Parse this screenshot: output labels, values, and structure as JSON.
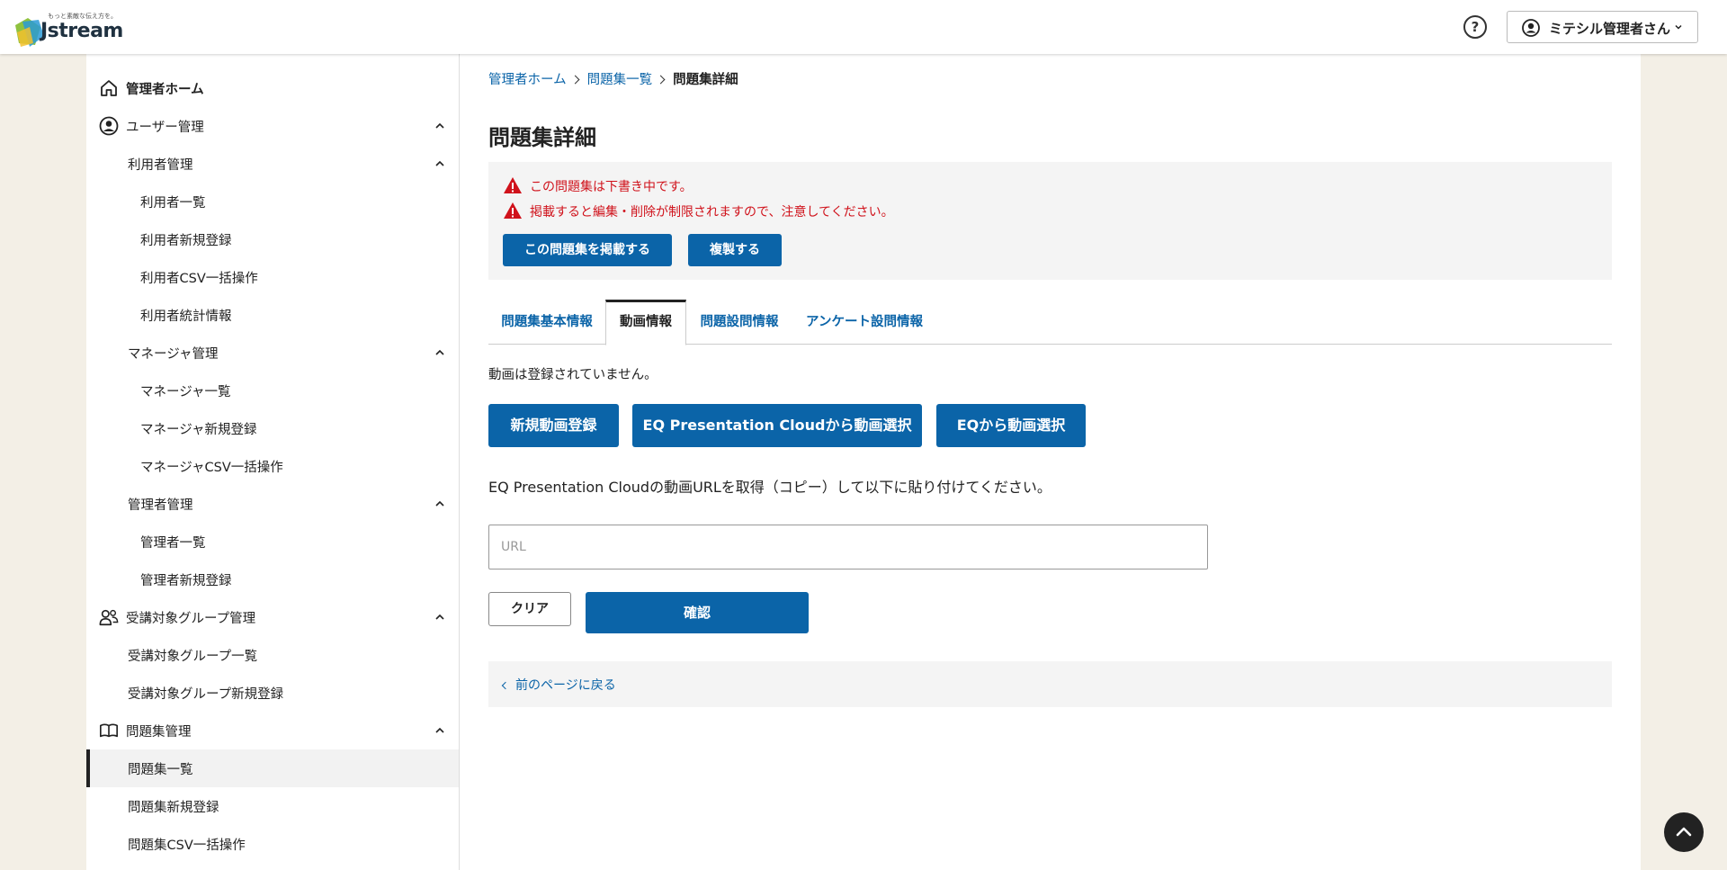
{
  "header": {
    "logo_tagline": "もっと素敵な伝え方を。",
    "logo_text": "Jstream",
    "help_label": "?",
    "user_name": "ミテシル管理者さん"
  },
  "sidebar": {
    "home": "管理者ホーム",
    "user_mgmt": "ユーザー管理",
    "user_sub": "利用者管理",
    "user_list": "利用者一覧",
    "user_new": "利用者新規登録",
    "user_csv": "利用者CSV一括操作",
    "user_stats": "利用者統計情報",
    "manager_sub": "マネージャ管理",
    "manager_list": "マネージャ一覧",
    "manager_new": "マネージャ新規登録",
    "manager_csv": "マネージャCSV一括操作",
    "admin_sub": "管理者管理",
    "admin_list": "管理者一覧",
    "admin_new": "管理者新規登録",
    "group_mgmt": "受講対象グループ管理",
    "group_list": "受講対象グループ一覧",
    "group_new": "受講対象グループ新規登録",
    "quiz_mgmt": "問題集管理",
    "quiz_list": "問題集一覧",
    "quiz_new": "問題集新規登録",
    "quiz_csv": "問題集CSV一括操作"
  },
  "breadcrumb": {
    "home": "管理者ホーム",
    "list": "問題集一覧",
    "current": "問題集詳細"
  },
  "page": {
    "title": "問題集詳細"
  },
  "alert": {
    "line1": "この問題集は下書き中です。",
    "line2": "掲載すると編集・削除が制限されますので、注意してください。",
    "publish_button": "この問題集を掲載する",
    "duplicate_button": "複製する"
  },
  "tabs": {
    "basic": "問題集基本情報",
    "video": "動画情報",
    "questions": "問題設問情報",
    "survey": "アンケート設問情報"
  },
  "video": {
    "empty_message": "動画は登録されていません。",
    "new_button": "新規動画登録",
    "eqpc_button": "EQ Presentation Cloudから動画選択",
    "eq_button": "EQから動画選択",
    "instruction": "EQ Presentation Cloudの動画URLを取得（コピー）して以下に貼り付けてください。",
    "url_placeholder": "URL",
    "url_value": "",
    "clear_button": "クリア",
    "confirm_button": "確認"
  },
  "back": {
    "label": "前のページに戻る"
  },
  "colors": {
    "primary": "#0b64a8",
    "alert": "#d0121b",
    "background": "#f3efe6"
  }
}
